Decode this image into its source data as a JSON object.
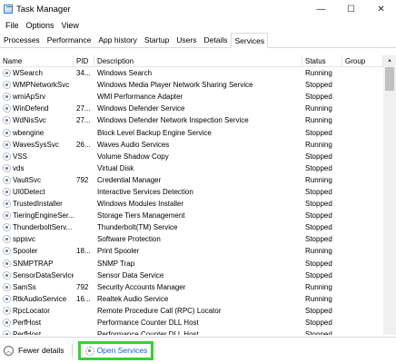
{
  "window": {
    "title": "Task Manager",
    "minimize": "—",
    "maximize": "☐",
    "close": "✕"
  },
  "menu": [
    "File",
    "Options",
    "View"
  ],
  "tabs": [
    "Processes",
    "Performance",
    "App history",
    "Startup",
    "Users",
    "Details",
    "Services"
  ],
  "active_tab": "Services",
  "columns": {
    "name": "Name",
    "pid": "PID",
    "description": "Description",
    "status": "Status",
    "group": "Group"
  },
  "services": [
    {
      "name": "WSearch",
      "pid": "34...",
      "description": "Windows Search",
      "status": "Running",
      "group": ""
    },
    {
      "name": "WMPNetworkSvc",
      "pid": "",
      "description": "Windows Media Player Network Sharing Service",
      "status": "Stopped",
      "group": ""
    },
    {
      "name": "wmiApSrv",
      "pid": "",
      "description": "WMI Performance Adapter",
      "status": "Stopped",
      "group": ""
    },
    {
      "name": "WinDefend",
      "pid": "27...",
      "description": "Windows Defender Service",
      "status": "Running",
      "group": ""
    },
    {
      "name": "WdNisSvc",
      "pid": "27...",
      "description": "Windows Defender Network Inspection Service",
      "status": "Running",
      "group": ""
    },
    {
      "name": "wbengine",
      "pid": "",
      "description": "Block Level Backup Engine Service",
      "status": "Stopped",
      "group": ""
    },
    {
      "name": "WavesSysSvc",
      "pid": "26...",
      "description": "Waves Audio Services",
      "status": "Running",
      "group": ""
    },
    {
      "name": "VSS",
      "pid": "",
      "description": "Volume Shadow Copy",
      "status": "Stopped",
      "group": ""
    },
    {
      "name": "vds",
      "pid": "",
      "description": "Virtual Disk",
      "status": "Stopped",
      "group": ""
    },
    {
      "name": "VaultSvc",
      "pid": "792",
      "description": "Credential Manager",
      "status": "Running",
      "group": ""
    },
    {
      "name": "UI0Detect",
      "pid": "",
      "description": "Interactive Services Detection",
      "status": "Stopped",
      "group": ""
    },
    {
      "name": "TrustedInstaller",
      "pid": "",
      "description": "Windows Modules Installer",
      "status": "Stopped",
      "group": ""
    },
    {
      "name": "TieringEngineSer...",
      "pid": "",
      "description": "Storage Tiers Management",
      "status": "Stopped",
      "group": ""
    },
    {
      "name": "ThunderboltServ...",
      "pid": "",
      "description": "Thunderbolt(TM) Service",
      "status": "Stopped",
      "group": ""
    },
    {
      "name": "sppsvc",
      "pid": "",
      "description": "Software Protection",
      "status": "Stopped",
      "group": ""
    },
    {
      "name": "Spooler",
      "pid": "18...",
      "description": "Print Spooler",
      "status": "Running",
      "group": ""
    },
    {
      "name": "SNMPTRAP",
      "pid": "",
      "description": "SNMP Trap",
      "status": "Stopped",
      "group": ""
    },
    {
      "name": "SensorDataService",
      "pid": "",
      "description": "Sensor Data Service",
      "status": "Stopped",
      "group": ""
    },
    {
      "name": "SamSs",
      "pid": "792",
      "description": "Security Accounts Manager",
      "status": "Running",
      "group": ""
    },
    {
      "name": "RtkAudioService",
      "pid": "16...",
      "description": "Realtek Audio Service",
      "status": "Running",
      "group": ""
    },
    {
      "name": "RpcLocator",
      "pid": "",
      "description": "Remote Procedure Call (RPC) Locator",
      "status": "Stopped",
      "group": ""
    },
    {
      "name": "PerfHost",
      "pid": "",
      "description": "Performance Counter DLL Host",
      "status": "Stopped",
      "group": ""
    },
    {
      "name": "PerfHost",
      "pid": "",
      "description": "Performance Counter DLL Host",
      "status": "Stopped",
      "group": ""
    }
  ],
  "footer": {
    "fewer_details": "Fewer details",
    "open_services": "Open Services"
  },
  "icons": {
    "service": "gear-icon",
    "fewer_details": "chevron-up-icon",
    "open_services": "gear-icon"
  },
  "colors": {
    "highlight_border": "#33d233",
    "link": "#1b5fbf"
  }
}
